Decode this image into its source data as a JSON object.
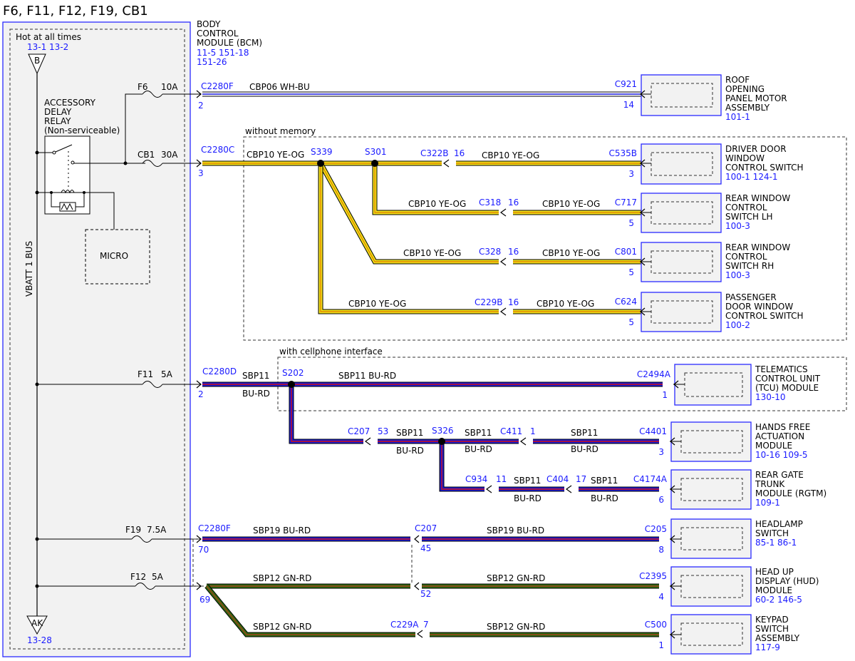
{
  "title": "F6, F11, F12, F19, CB1",
  "bcm": {
    "lines": [
      "BODY",
      "CONTROL",
      "MODULE (BCM)"
    ],
    "refs": [
      "11-5    151-18",
      "151-26"
    ]
  },
  "power": {
    "hot_label": "Hot at all times",
    "top_refs": "13-1   13-2",
    "top_connector": "B",
    "bus_label": "VBATT 1 BUS",
    "bottom_connector": "AK",
    "bottom_ref": "13-28",
    "relay": [
      "ACCESSORY",
      "DELAY",
      "RELAY",
      "(Non-serviceable)"
    ],
    "micro": "MICRO"
  },
  "fuses": {
    "f6": {
      "name": "F6",
      "rating": "10A"
    },
    "cb1": {
      "name": "CB1",
      "rating": "30A"
    },
    "f11": {
      "name": "F11",
      "rating": "5A"
    },
    "f19": {
      "name": "F19",
      "rating": "7.5A"
    },
    "f12": {
      "name": "F12",
      "rating": "5A"
    }
  },
  "groups": {
    "without_memory": "without memory",
    "cellphone": "with cellphone interface"
  },
  "bcm_connectors": {
    "c2280f_top": {
      "name": "C2280F",
      "pin": "2"
    },
    "c2280c": {
      "name": "C2280C",
      "pin": "3"
    },
    "c2280d": {
      "name": "C2280D",
      "pin": "2"
    },
    "c2280f_bot": {
      "name": "C2280F",
      "pin": "70"
    },
    "pin69": "69"
  },
  "splices": {
    "s339": "S339",
    "s301": "S301",
    "s202": "S202",
    "s326": "S326"
  },
  "inline": {
    "c322b": "C322B",
    "c322b_pin": "16",
    "c318": "C318",
    "c318_pin": "16",
    "c328": "C328",
    "c328_pin": "16",
    "c229b": "C229B",
    "c229b_pin": "16",
    "c207a": "C207",
    "c207a_pin": "53",
    "c411": "C411",
    "c411_pin": "1",
    "c934": "C934",
    "c934_pin": "11",
    "c404": "C404",
    "c404_pin": "17",
    "c207b": "C207",
    "c207b_pin45": "45",
    "c207b_pin52": "52",
    "c229a": "C229A",
    "c229a_pin": "7"
  },
  "wires": {
    "cbp06": "CBP06   WH-BU",
    "cbp10": "CBP10   YE-OG",
    "sbp11": "SBP11",
    "bu_rd": "BU-RD",
    "sbp11_bu_rd": "SBP11       BU-RD",
    "sbp19": "SBP19   BU-RD",
    "sbp12": "SBP12   GN-RD"
  },
  "components": {
    "roof": {
      "conn": "C921",
      "pin": "14",
      "lines": [
        "ROOF",
        "OPENING",
        "PANEL MOTOR",
        "ASSEMBLY"
      ],
      "ref": "101-1"
    },
    "driver": {
      "conn": "C535B",
      "pin": "3",
      "lines": [
        "DRIVER DOOR",
        "WINDOW",
        "CONTROL SWITCH"
      ],
      "ref": "100-1  124-1"
    },
    "rear_lh": {
      "conn": "C717",
      "pin": "5",
      "lines": [
        "REAR WINDOW",
        "CONTROL",
        "SWITCH LH"
      ],
      "ref": "100-3"
    },
    "rear_rh": {
      "conn": "C801",
      "pin": "5",
      "lines": [
        "REAR WINDOW",
        "CONTROL",
        "SWITCH RH"
      ],
      "ref": "100-3"
    },
    "pass": {
      "conn": "C624",
      "pin": "5",
      "lines": [
        "PASSENGER",
        "DOOR WINDOW",
        "CONTROL SWITCH"
      ],
      "ref": "100-2"
    },
    "tcu": {
      "conn": "C2494A",
      "pin": "1",
      "lines": [
        "TELEMATICS",
        "CONTROL UNIT",
        "(TCU) MODULE"
      ],
      "ref": "130-10"
    },
    "hfa": {
      "conn": "C4401",
      "pin": "3",
      "lines": [
        "HANDS FREE",
        "ACTUATION",
        "MODULE"
      ],
      "ref": "10-16  109-5"
    },
    "rgtm": {
      "conn": "C4174A",
      "pin": "6",
      "lines": [
        "REAR GATE",
        "TRUNK",
        "MODULE (RGTM)"
      ],
      "ref": "109-1"
    },
    "headlamp": {
      "conn": "C205",
      "pin": "8",
      "lines": [
        "HEADLAMP",
        "SWITCH"
      ],
      "ref": "85-1   86-1"
    },
    "hud": {
      "conn": "C2395",
      "pin": "4",
      "lines": [
        "HEAD UP",
        "DISPLAY (HUD)",
        "MODULE"
      ],
      "ref": "60-2   146-5"
    },
    "keypad": {
      "conn": "C500",
      "pin": "1",
      "lines": [
        "KEYPAD",
        "SWITCH",
        "ASSEMBLY"
      ],
      "ref": "117-9"
    }
  },
  "colors": {
    "module_border": "#2a2aff",
    "wire_yellow": "#f0e21a",
    "wire_blue": "#1a1ad8",
    "wire_red": "#d01010",
    "wire_green": "#2e6b10",
    "wire_white": "#ffffff",
    "ref_text": "#1a1aff"
  }
}
